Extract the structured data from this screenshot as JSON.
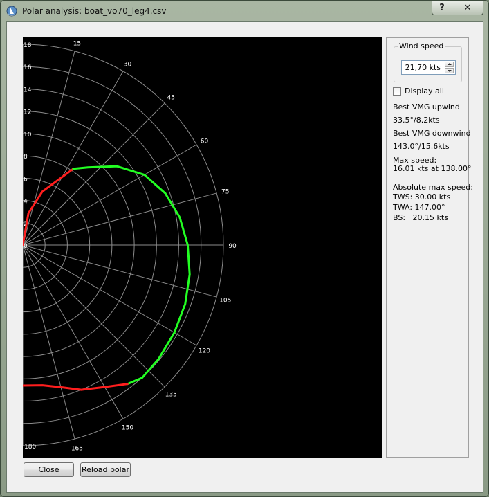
{
  "window": {
    "title": "Polar analysis: boat_vo70_leg4.csv",
    "help_label": "?",
    "close_label": "✕"
  },
  "wind_group": {
    "title": "Wind speed",
    "value": "21,70 kts"
  },
  "display_all": {
    "label": "Display all",
    "checked": false
  },
  "stats": {
    "vmg_up_label": "Best VMG upwind",
    "vmg_up_value": "33.5°/8.2kts",
    "vmg_down_label": "Best VMG downwind",
    "vmg_down_value": "143.0°/15.6kts",
    "max_speed_label": "Max speed:",
    "max_speed_value": "16.01 kts at 138.00°",
    "abs_label": "Absolute max speed:",
    "abs_tws": "TWS: 30.00 kts",
    "abs_twa": "TWA: 147.00°",
    "abs_bs": "BS:   20.15 kts"
  },
  "buttons": {
    "close": "Close",
    "reload": "Reload polar"
  },
  "colors": {
    "plot_bg": "#000000",
    "grid": "#8c8c8c",
    "good": "#22ff22",
    "bad": "#ff1e1e"
  },
  "chart_data": {
    "type": "polar",
    "radial_ticks": [
      "0",
      "2",
      "4",
      "6",
      "8",
      "10",
      "12",
      "14",
      "16",
      "18"
    ],
    "radial_max": 18,
    "angle_ticks": [
      "15",
      "30",
      "45",
      "60",
      "75",
      "90",
      "105",
      "120",
      "135",
      "150",
      "165",
      "180"
    ],
    "series": [
      {
        "color": "#ff1e1e",
        "points": [
          [
            0,
            0
          ],
          [
            10,
            2.9
          ],
          [
            20,
            5.1
          ],
          [
            33.5,
            8.2
          ]
        ]
      },
      {
        "color": "#22ff22",
        "points": [
          [
            33.5,
            8.2
          ],
          [
            40,
            9.1
          ],
          [
            50,
            11.0
          ],
          [
            60,
            12.6
          ],
          [
            70,
            13.6
          ],
          [
            80,
            14.3
          ],
          [
            90,
            14.8
          ],
          [
            100,
            15.2
          ],
          [
            110,
            15.5
          ],
          [
            120,
            15.7
          ],
          [
            130,
            15.9
          ],
          [
            138,
            16.01
          ],
          [
            143,
            15.6
          ]
        ]
      },
      {
        "color": "#ff1e1e",
        "points": [
          [
            143,
            15.6
          ],
          [
            150,
            14.7
          ],
          [
            158,
            14.0
          ],
          [
            165,
            13.2
          ],
          [
            172,
            12.7
          ],
          [
            180,
            12.6
          ]
        ]
      }
    ]
  }
}
